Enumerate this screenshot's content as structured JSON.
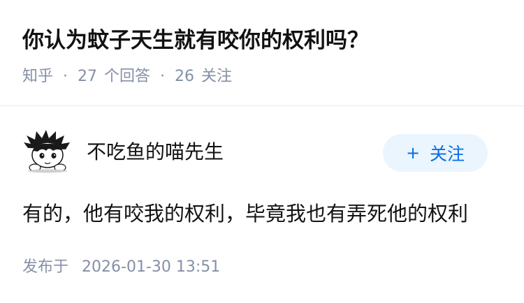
{
  "question": {
    "title": "你认为蚊子天生就有咬你的权利吗？"
  },
  "meta": {
    "source": "知乎",
    "separator": "·",
    "answers_count": "27",
    "answers_label": "个回答",
    "followers_count": "26",
    "followers_label": "关注"
  },
  "answer": {
    "author": {
      "name": "不吃鱼的喵先生",
      "avatar_icon": "cartoon-avatar-icon"
    },
    "follow_button": {
      "icon": "+",
      "label": "关注"
    },
    "content": "有的，他有咬我的权利，毕竟我也有弄死他的权利",
    "publish_label": "发布于",
    "publish_time": "2026-01-30 13:51"
  },
  "colors": {
    "title": "#121212",
    "meta": "#8590a6",
    "follow_bg": "#ebf5fd",
    "follow_text": "#056de8",
    "divider": "#ebebeb"
  }
}
